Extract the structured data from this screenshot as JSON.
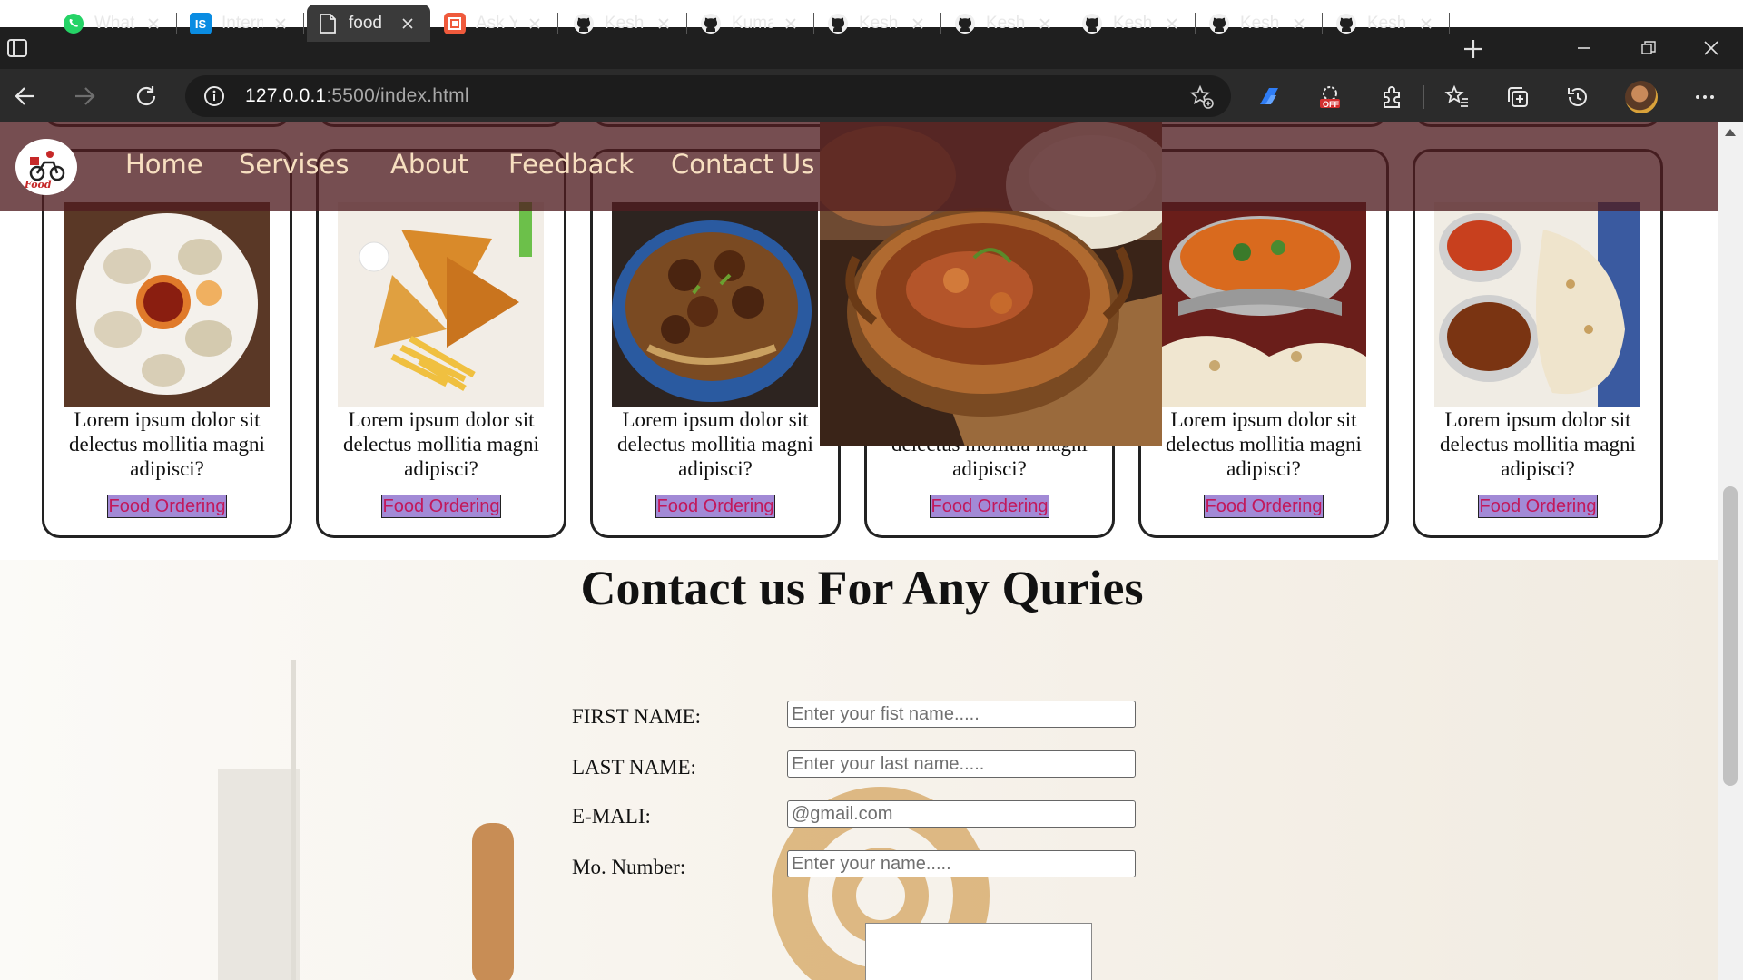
{
  "browser": {
    "tabs": [
      {
        "label": "What",
        "icon": "whatsapp-icon"
      },
      {
        "label": "Intern",
        "icon": "internshala-icon"
      },
      {
        "label": "food",
        "icon": "page-icon",
        "active": true
      },
      {
        "label": "Ask Y",
        "icon": "ask-icon"
      },
      {
        "label": "Kesh",
        "icon": "github-icon"
      },
      {
        "label": "Kuma",
        "icon": "github-icon"
      },
      {
        "label": "Kesh",
        "icon": "github-icon"
      },
      {
        "label": "Kesh",
        "icon": "github-icon"
      },
      {
        "label": "Kesh",
        "icon": "github-icon"
      },
      {
        "label": "Kesh",
        "icon": "github-icon"
      },
      {
        "label": "Kesh",
        "icon": "github-icon"
      }
    ],
    "url_host": "127.0.0.1",
    "url_rest": ":5500/index.html",
    "toolbar_icons": [
      "favorite-add-icon",
      "copilot-icon",
      "adblock-off-icon",
      "extensions-icon",
      "favorites-icon",
      "collections-icon",
      "history-icon",
      "profile-avatar",
      "more-icon"
    ],
    "adblock_badge": "OFF"
  },
  "site": {
    "logo_text": "Food",
    "nav": [
      "Home",
      "Servises",
      "About",
      "Feedback",
      "Contact Us"
    ],
    "cards": [
      {
        "text": "Lorem ipsum dolor sit delectus mollitia magni adipisci?",
        "button": "Food Ordering",
        "image": "momos-image"
      },
      {
        "text": "Lorem ipsum dolor sit delectus mollitia magni adipisci?",
        "button": "Food Ordering",
        "image": "sandwich-fries-image"
      },
      {
        "text": "Lorem ipsum dolor sit delectus mollitia magni adipisci?",
        "button": "Food Ordering",
        "image": "noodles-manchurian-image"
      },
      {
        "text": "Lorem ipsum dolor sit delectus mollitia magni adipisci?",
        "button": "Food Ordering",
        "image": "hidden-under-hero"
      },
      {
        "text": "Lorem ipsum dolor sit delectus mollitia magni adipisci?",
        "button": "Food Ordering",
        "image": "butter-chicken-naan-image"
      },
      {
        "text": "Lorem ipsum dolor sit delectus mollitia magni adipisci?",
        "button": "Food Ordering",
        "image": "curry-naan-image"
      }
    ],
    "contact": {
      "title": "Contact us For Any Quries",
      "fields": [
        {
          "label": "FIRST NAME:",
          "placeholder": "Enter your fist name....."
        },
        {
          "label": "LAST NAME:",
          "placeholder": "Enter your last name....."
        },
        {
          "label": "E-MALI:",
          "placeholder": "@gmail.com"
        },
        {
          "label": "Mo. Number:",
          "placeholder": "Enter your name....."
        }
      ]
    }
  },
  "colors": {
    "navbar": "#501c20",
    "nav_text": "#f7dfc0",
    "button_bg": "#a28ad6",
    "button_text": "#c2185b"
  }
}
